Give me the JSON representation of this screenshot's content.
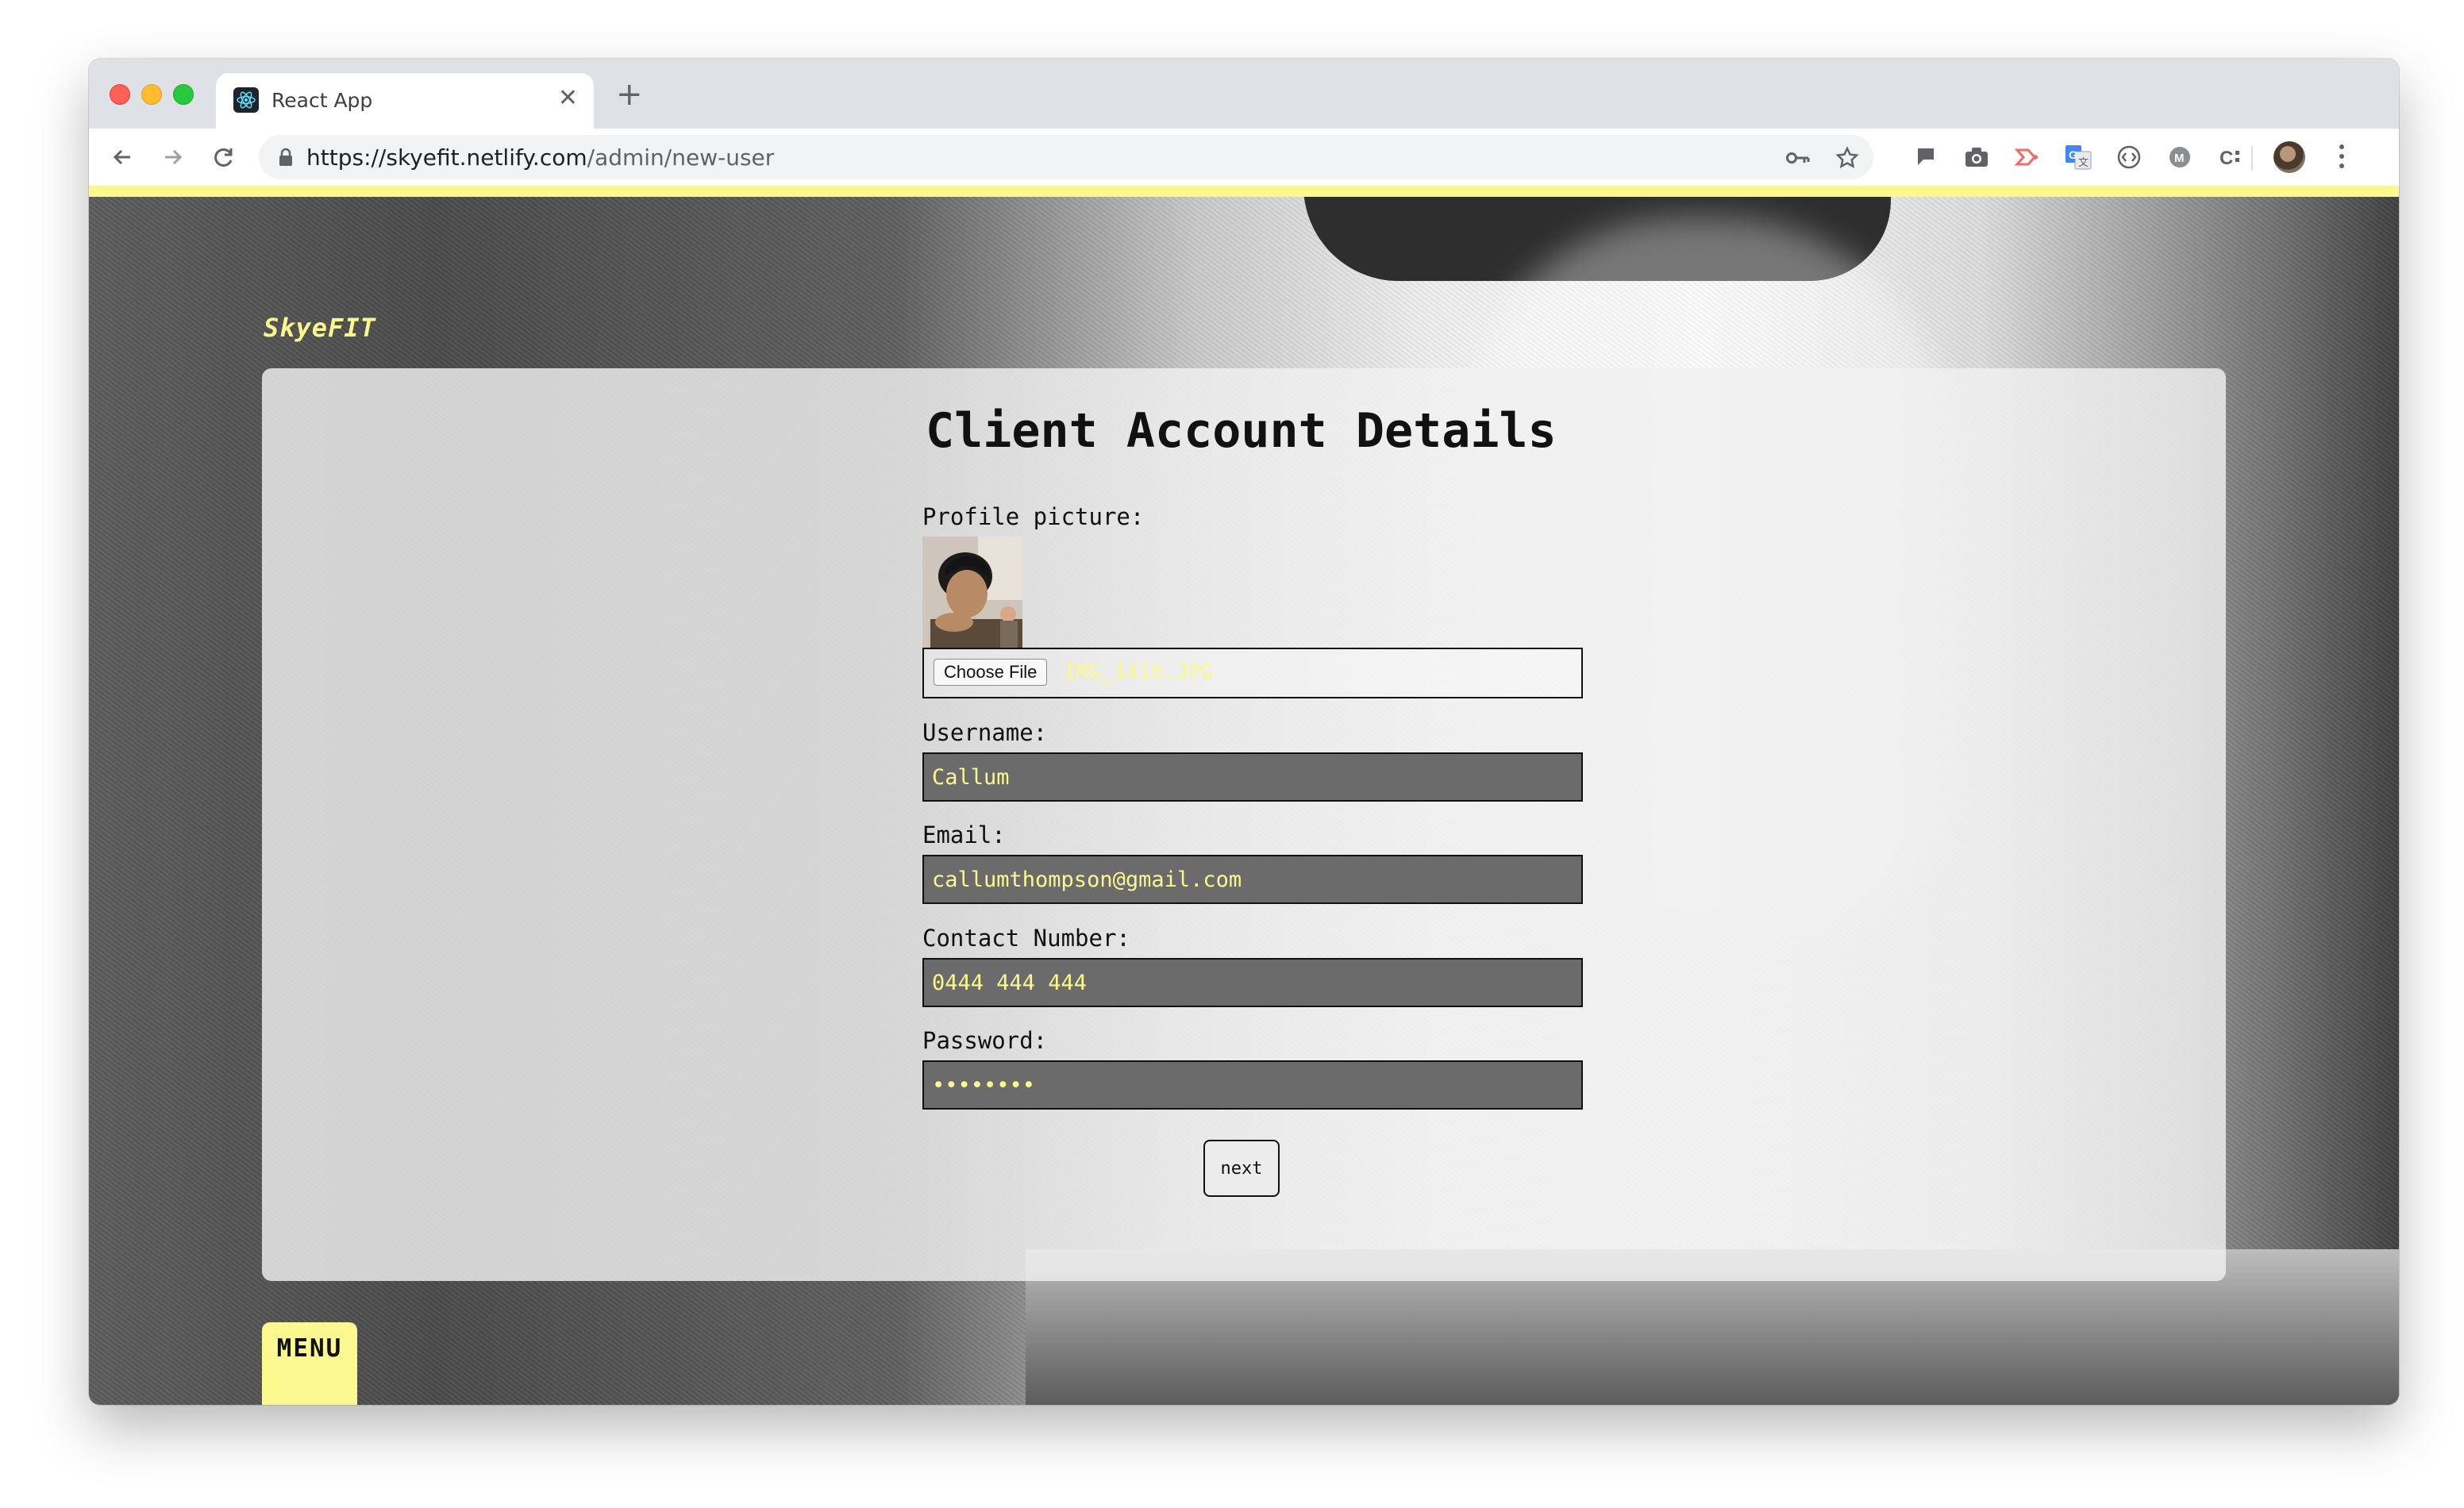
{
  "browser": {
    "tab": {
      "title": "React App",
      "favicon": "react-icon"
    },
    "address_bar": {
      "url_host": "https://skyefit.netlify.com",
      "url_path": "/admin/new-user"
    },
    "extensions": [
      "key-icon",
      "star-icon",
      "flag-extension-icon",
      "camera-extension-icon",
      "screencast-extension-icon",
      "translate-extension-icon",
      "dev-extension-icon",
      "m-extension-icon",
      "c-extension-icon"
    ]
  },
  "app": {
    "brand": "SkyeFIT",
    "accent_color": "#fcf890",
    "menu_label": "MENU"
  },
  "form": {
    "title": "Client Account Details",
    "profile_label": "Profile picture:",
    "choose_file_label": "Choose File",
    "file_name": "IMG_1416.JPG",
    "username_label": "Username:",
    "username_value": "Callum",
    "email_label": "Email:",
    "email_value": "callumthompson@gmail.com",
    "contact_label": "Contact Number:",
    "contact_value": "0444 444 444",
    "password_label": "Password:",
    "password_value": "abc12345",
    "next_label": "next"
  }
}
